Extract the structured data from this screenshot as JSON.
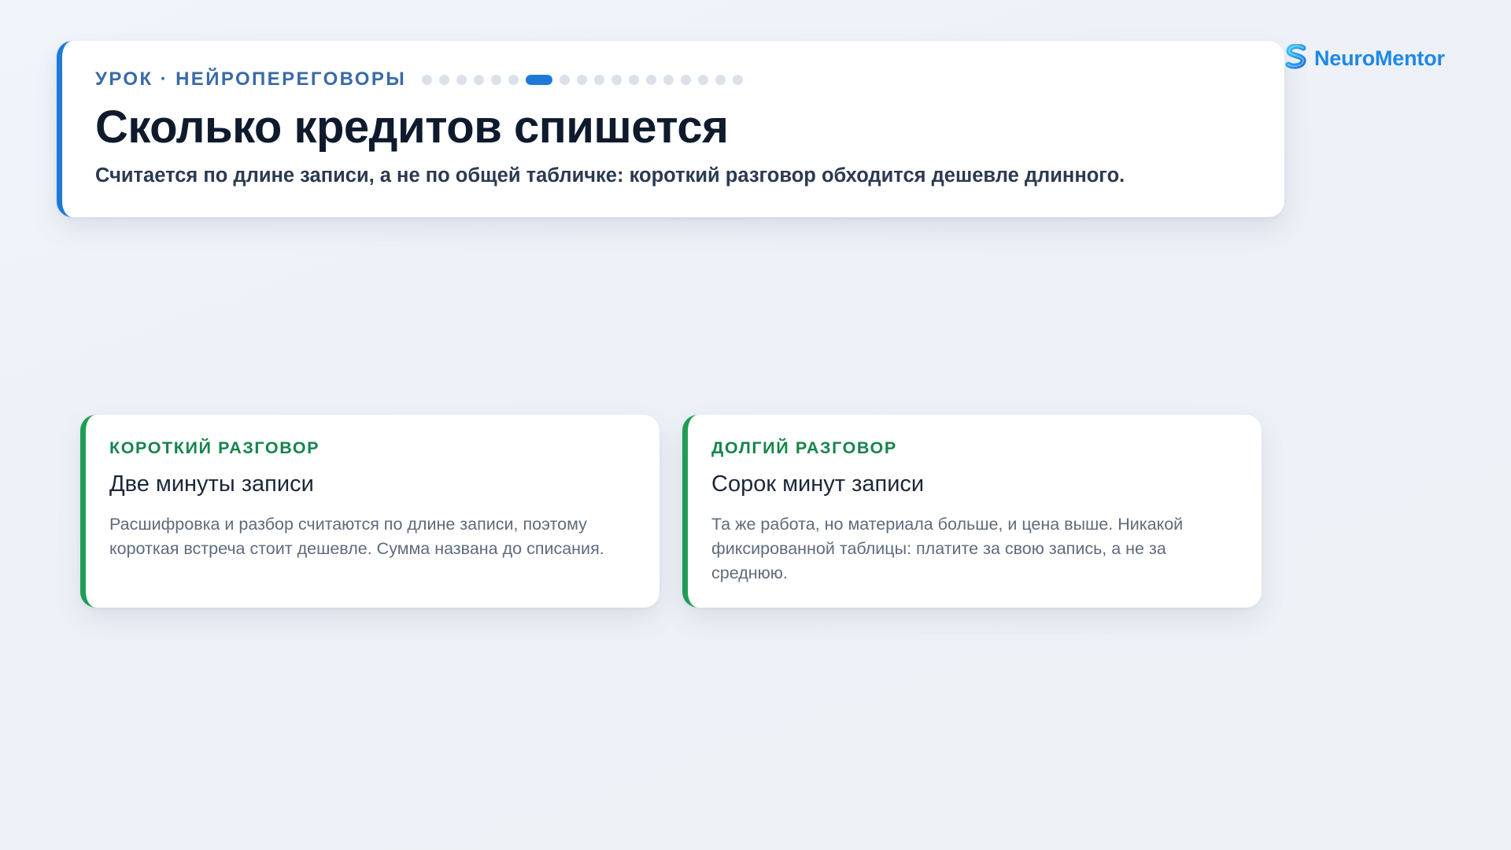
{
  "header": {
    "eyebrow": "УРОК · НЕЙРОПЕРЕГОВОРЫ",
    "title": "Сколько кредитов спишется",
    "subtitle": "Считается по длине записи, а не по общей табличке: короткий разговор обходится дешевле длинного.",
    "progress": {
      "total_steps": 18,
      "current_step": 7
    }
  },
  "brand": {
    "name": "NeuroMentor",
    "icon": "neuromentor-logo-icon",
    "color": "#1e88e5"
  },
  "cards": [
    {
      "label": "КОРОТКИЙ РАЗГОВОР",
      "title": "Две минуты записи",
      "text": "Расшифровка и разбор считаются по длине записи, поэтому короткая встреча стоит дешевле. Сумма названа до списания."
    },
    {
      "label": "ДОЛГИЙ РАЗГОВОР",
      "title": "Сорок минут записи",
      "text": "Та же работа, но материала больше, и цена выше. Никакой фиксированной таблицы: платите за свою запись, а не за среднюю."
    }
  ],
  "colors": {
    "accent": "#1d7ad8",
    "card_accent": "#1f9d55",
    "label_green": "#17844a",
    "title": "#0f1b2d"
  }
}
